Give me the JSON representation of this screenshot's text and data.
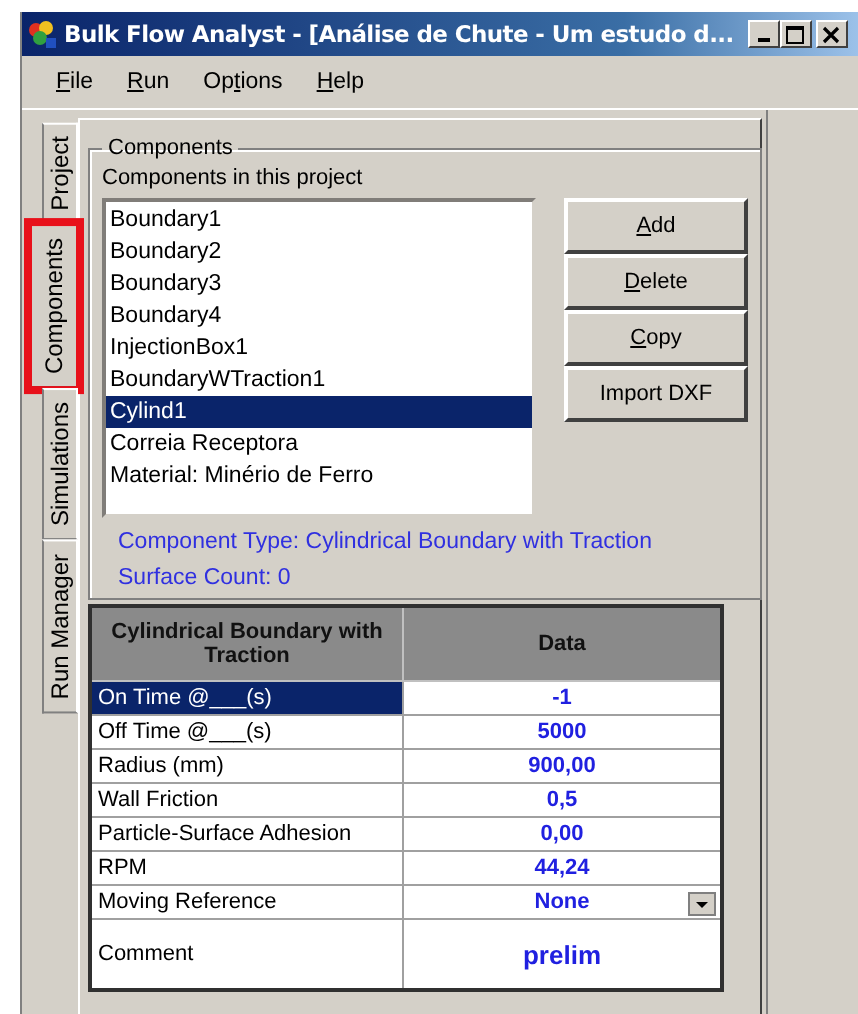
{
  "window": {
    "title": "Bulk Flow Analyst - [Análise de Chute - Um estudo d..."
  },
  "menu": [
    {
      "key": "F",
      "after": "ile"
    },
    {
      "key": "R",
      "after": "un"
    },
    {
      "before": "Op",
      "key": "t",
      "after": "ions"
    },
    {
      "key": "H",
      "after": "elp"
    }
  ],
  "side_tabs": [
    {
      "label": "Project",
      "selected": false,
      "highlighted": false
    },
    {
      "label": "Components",
      "selected": true,
      "highlighted": true
    },
    {
      "label": "Simulations",
      "selected": false,
      "highlighted": false
    },
    {
      "label": "Run Manager",
      "selected": false,
      "highlighted": false
    }
  ],
  "group": {
    "title": "Components",
    "list_label": "Components in this project",
    "items": [
      {
        "label": "Boundary1",
        "selected": false
      },
      {
        "label": "Boundary2",
        "selected": false
      },
      {
        "label": "Boundary3",
        "selected": false
      },
      {
        "label": "Boundary4",
        "selected": false
      },
      {
        "label": "InjectionBox1",
        "selected": false
      },
      {
        "label": "BoundaryWTraction1",
        "selected": false
      },
      {
        "label": "Cylind1",
        "selected": true
      },
      {
        "label": "Correia Receptora",
        "selected": false
      },
      {
        "label": "Material: Minério de Ferro",
        "selected": false
      }
    ],
    "buttons": [
      {
        "key": "A",
        "after": "dd"
      },
      {
        "key": "D",
        "after": "elete"
      },
      {
        "key": "C",
        "after": "opy"
      },
      {
        "before": "Import DXF"
      }
    ],
    "component_type": "Component Type: Cylindrical Boundary with Traction",
    "surface_count": "Surface Count: 0"
  },
  "table": {
    "columns": [
      "Cylindrical Boundary with Traction",
      "Data"
    ],
    "rows": [
      {
        "name": "On Time @___(s)",
        "value": "-1",
        "kind": "text",
        "selected": true
      },
      {
        "name": "Off Time @___(s)",
        "value": "5000",
        "kind": "text",
        "selected": false
      },
      {
        "name": "Radius  (mm)",
        "value": "900,00",
        "kind": "text",
        "selected": false
      },
      {
        "name": "Wall Friction",
        "value": "0,5",
        "kind": "text",
        "selected": false
      },
      {
        "name": "Particle-Surface Adhesion",
        "value": "0,00",
        "kind": "text",
        "selected": false
      },
      {
        "name": "RPM",
        "value": "44,24",
        "kind": "text",
        "selected": false
      },
      {
        "name": "Moving Reference",
        "value": "None",
        "kind": "dropdown",
        "selected": false
      },
      {
        "name": "Comment",
        "value": "prelim",
        "kind": "memo",
        "selected": false
      }
    ]
  }
}
